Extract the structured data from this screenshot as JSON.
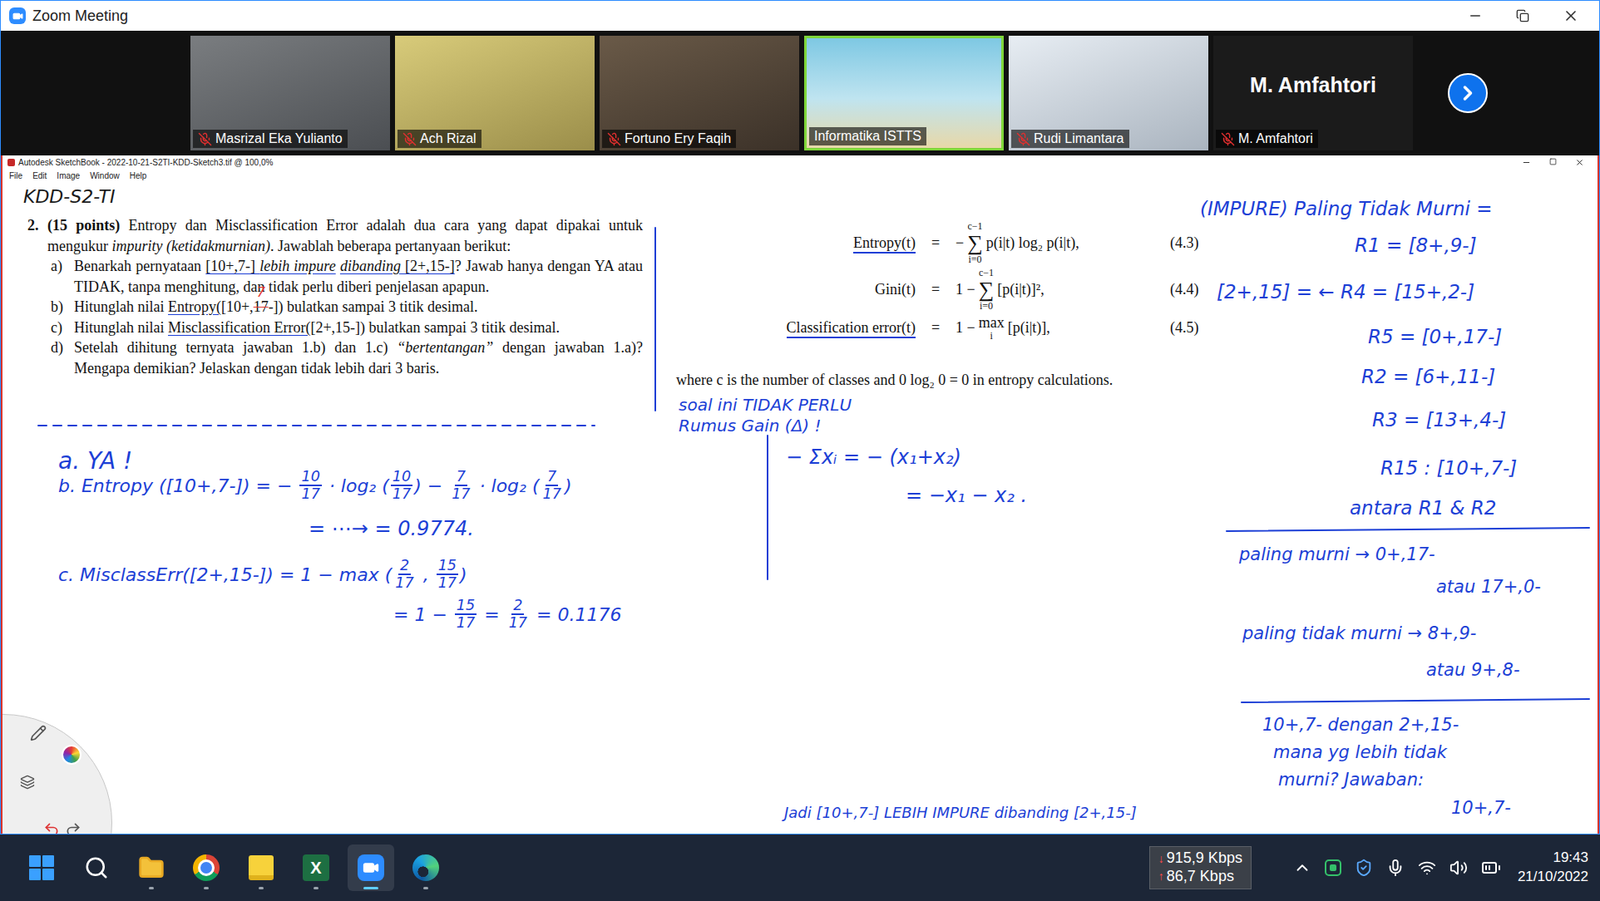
{
  "zoom": {
    "title": "Zoom Meeting",
    "participants": [
      {
        "name": "Masrizal Eka Yulianto",
        "muted": true,
        "video": true,
        "active": false
      },
      {
        "name": "Ach Rizal",
        "muted": true,
        "video": true,
        "active": false
      },
      {
        "name": "Fortuno Ery Faqih",
        "muted": true,
        "video": true,
        "active": false
      },
      {
        "name": "Informatika ISTTS",
        "muted": false,
        "video": true,
        "active": true
      },
      {
        "name": "Rudi Limantara",
        "muted": true,
        "video": true,
        "active": false
      },
      {
        "name": "M. Amfahtori",
        "muted": true,
        "video": false,
        "active": false
      }
    ]
  },
  "sketchbook": {
    "title": "Autodesk SketchBook - 2022-10-21-S2TI-KDD-Sketch3.tif @ 100,0%",
    "menu": [
      "File",
      "Edit",
      "Image",
      "Window",
      "Help"
    ]
  },
  "document": {
    "question": {
      "number": "2.",
      "intro": [
        {
          "t": "(15 points)",
          "b": true
        },
        {
          "t": " Entropy dan Misclassification Error adalah dua cara yang dapat dipakai untuk mengukur "
        },
        {
          "t": "impurity (ketidakmurnian)",
          "i": true
        },
        {
          "t": ". Jawablah beberapa pertanyaan berikut:"
        }
      ],
      "items": [
        {
          "label": "a)",
          "parts": [
            {
              "t": "Benarkah pernyataan "
            },
            {
              "t": "[10+,7-] ",
              "u": true
            },
            {
              "t": "lebih impure",
              "i": true,
              "u": true
            },
            {
              "t": " "
            },
            {
              "t": "dibanding",
              "i": true,
              "u": true
            },
            {
              "t": " [2+,15-]",
              "u": true
            },
            {
              "t": "? Jawab hanya dengan YA atau TIDAK, tanpa menghitung, dan tidak perlu diberi penjelasan apapun."
            }
          ]
        },
        {
          "label": "b)",
          "parts": [
            {
              "t": "Hitunglah nilai "
            },
            {
              "t": "Entropy(",
              "u": true
            },
            {
              "t": "[10+,"
            },
            {
              "t": "17",
              "strike": true,
              "note": "7"
            },
            {
              "t": "-]) bulatkan sampai 3 titik desimal."
            }
          ]
        },
        {
          "label": "c)",
          "parts": [
            {
              "t": "Hitunglah nilai "
            },
            {
              "t": "Misclassification Error(",
              "u": true
            },
            {
              "t": "[2+,15-]) bulatkan sampai 3 titik desimal."
            }
          ]
        },
        {
          "label": "d)",
          "parts": [
            {
              "t": "Setelah dihitung ternyata jawaban 1.b) dan 1.c) "
            },
            {
              "t": "“bertentangan”",
              "i": true
            },
            {
              "t": " dengan jawaban 1.a)? Mengapa demikian? Jelaskan dengan tidak lebih dari 3 baris."
            }
          ]
        }
      ]
    },
    "formulas": [
      {
        "label": "Entropy(t)",
        "underlined": true,
        "eq": "=",
        "prefix": "−",
        "op": {
          "symbol": "∑",
          "top": "c−1",
          "bottom": "i=0"
        },
        "body": "p(i|t) log₂ p(i|t),",
        "number": "(4.3)"
      },
      {
        "label": "Gini(t)",
        "underlined": false,
        "eq": "=",
        "prefix": "1 −",
        "op": {
          "symbol": "∑",
          "top": "c−1",
          "bottom": "i=0"
        },
        "body": "[p(i|t)]²,",
        "number": "(4.4)"
      },
      {
        "label": "Classification error(t)",
        "underlined": true,
        "eq": "=",
        "prefix": "1 −",
        "op": {
          "symbol": "max",
          "bottom": "i"
        },
        "body": "[p(i|t)],",
        "number": "(4.5)"
      }
    ],
    "footnote": "where c is the number of classes and 0 log₂ 0 = 0 in entropy calculations."
  },
  "notes": [
    {
      "color": "#1a1a1a",
      "parts": [
        {
          "t": "KDD-S2-TI"
        }
      ]
    },
    {
      "color": "#1c3fd6",
      "parts": [
        {
          "t": "a. YA !"
        }
      ]
    },
    {
      "color": "#1c3fd6",
      "parts": [
        {
          "t": "b. Entropy ([10+,7-]) = − "
        },
        {
          "num": "10",
          "den": "17"
        },
        {
          "t": " · log₂ ("
        },
        {
          "num": "10",
          "den": "17"
        },
        {
          "t": ") − "
        },
        {
          "num": "7",
          "den": "17"
        },
        {
          "t": " · log₂ ("
        },
        {
          "num": "7",
          "den": "17"
        },
        {
          "t": ")"
        }
      ]
    },
    {
      "color": "#1c3fd6",
      "parts": [
        {
          "t": "= ⋯→ = 0.9774."
        }
      ]
    },
    {
      "color": "#1c3fd6",
      "parts": [
        {
          "t": "c. MisclassErr([2+,15-]) = 1 − max ("
        },
        {
          "num": "2",
          "den": "17"
        },
        {
          "t": " , "
        },
        {
          "num": "15",
          "den": "17"
        },
        {
          "t": ")"
        }
      ]
    },
    {
      "color": "#1c3fd6",
      "parts": [
        {
          "t": "= 1 − "
        },
        {
          "num": "15",
          "den": "17"
        },
        {
          "t": " = "
        },
        {
          "num": "2",
          "den": "17"
        },
        {
          "t": " = 0.1176"
        }
      ]
    },
    {
      "color": "#1c3fd6",
      "parts": [
        {
          "t": "soal ini TIDAK PERLU"
        }
      ]
    },
    {
      "color": "#1c3fd6",
      "parts": [
        {
          "t": "Rumus Gain (Δ) !"
        }
      ]
    },
    {
      "color": "#1c3fd6",
      "parts": [
        {
          "t": "− Σxᵢ = − (x₁+x₂)"
        }
      ]
    },
    {
      "color": "#1c3fd6",
      "parts": [
        {
          "t": "= −x₁ − x₂ ."
        }
      ]
    },
    {
      "color": "#1c3fd6",
      "parts": [
        {
          "t": "(IMPURE) Paling Tidak Murni ="
        }
      ]
    },
    {
      "color": "#1c3fd6",
      "parts": [
        {
          "t": "R1 = [8+,9-]"
        }
      ]
    },
    {
      "color": "#1c3fd6",
      "parts": [
        {
          "t": "[2+,15] = ← R4 = [15+,2-]"
        }
      ]
    },
    {
      "color": "#1c3fd6",
      "parts": [
        {
          "t": "R5 = [0+,17-]"
        }
      ]
    },
    {
      "color": "#1c3fd6",
      "parts": [
        {
          "t": "R2 = [6+,11-]"
        }
      ]
    },
    {
      "color": "#1c3fd6",
      "parts": [
        {
          "t": "R3 = [13+,4-]"
        }
      ]
    },
    {
      "color": "#1c3fd6",
      "parts": [
        {
          "t": "R15 : [10+,7-]"
        }
      ]
    },
    {
      "color": "#1c3fd6",
      "parts": [
        {
          "t": "antara R1 & R2"
        }
      ]
    },
    {
      "color": "#1c3fd6",
      "parts": [
        {
          "t": "paling murni → 0+,17-"
        }
      ]
    },
    {
      "color": "#1c3fd6",
      "parts": [
        {
          "t": "atau 17+,0-"
        }
      ]
    },
    {
      "color": "#1c3fd6",
      "parts": [
        {
          "t": "paling tidak murni → 8+,9-"
        }
      ]
    },
    {
      "color": "#1c3fd6",
      "parts": [
        {
          "t": "atau 9+,8-"
        }
      ]
    },
    {
      "color": "#1c3fd6",
      "parts": [
        {
          "t": "10+,7- dengan 2+,15-"
        }
      ]
    },
    {
      "color": "#1c3fd6",
      "parts": [
        {
          "t": "mana yg lebih tidak"
        }
      ]
    },
    {
      "color": "#1c3fd6",
      "parts": [
        {
          "t": "murni? Jawaban:"
        }
      ]
    },
    {
      "color": "#1c3fd6",
      "parts": [
        {
          "t": "10+,7-"
        }
      ]
    },
    {
      "color": "#1c3fd6",
      "parts": [
        {
          "t": "Jadi [10+,7-] LEBIH IMPURE dibanding [2+,15-]"
        }
      ]
    }
  ],
  "taskbar": {
    "apps": [
      {
        "kind": "start",
        "running": false,
        "active": false
      },
      {
        "kind": "search",
        "running": false,
        "active": false
      },
      {
        "kind": "explorer",
        "running": true,
        "active": false
      },
      {
        "kind": "chrome",
        "running": true,
        "active": false
      },
      {
        "kind": "sticky",
        "running": true,
        "active": false
      },
      {
        "kind": "excel",
        "glyph": "X",
        "running": true,
        "active": false
      },
      {
        "kind": "zoom",
        "running": true,
        "active": true
      },
      {
        "kind": "edge",
        "running": true,
        "active": false
      }
    ],
    "network": [
      {
        "arrow": "↓",
        "text": "915,9 Kbps"
      },
      {
        "arrow": "↑",
        "text": "86,7 Kbps"
      }
    ],
    "clock": {
      "time": "19:43",
      "date": "21/10/2022"
    }
  }
}
